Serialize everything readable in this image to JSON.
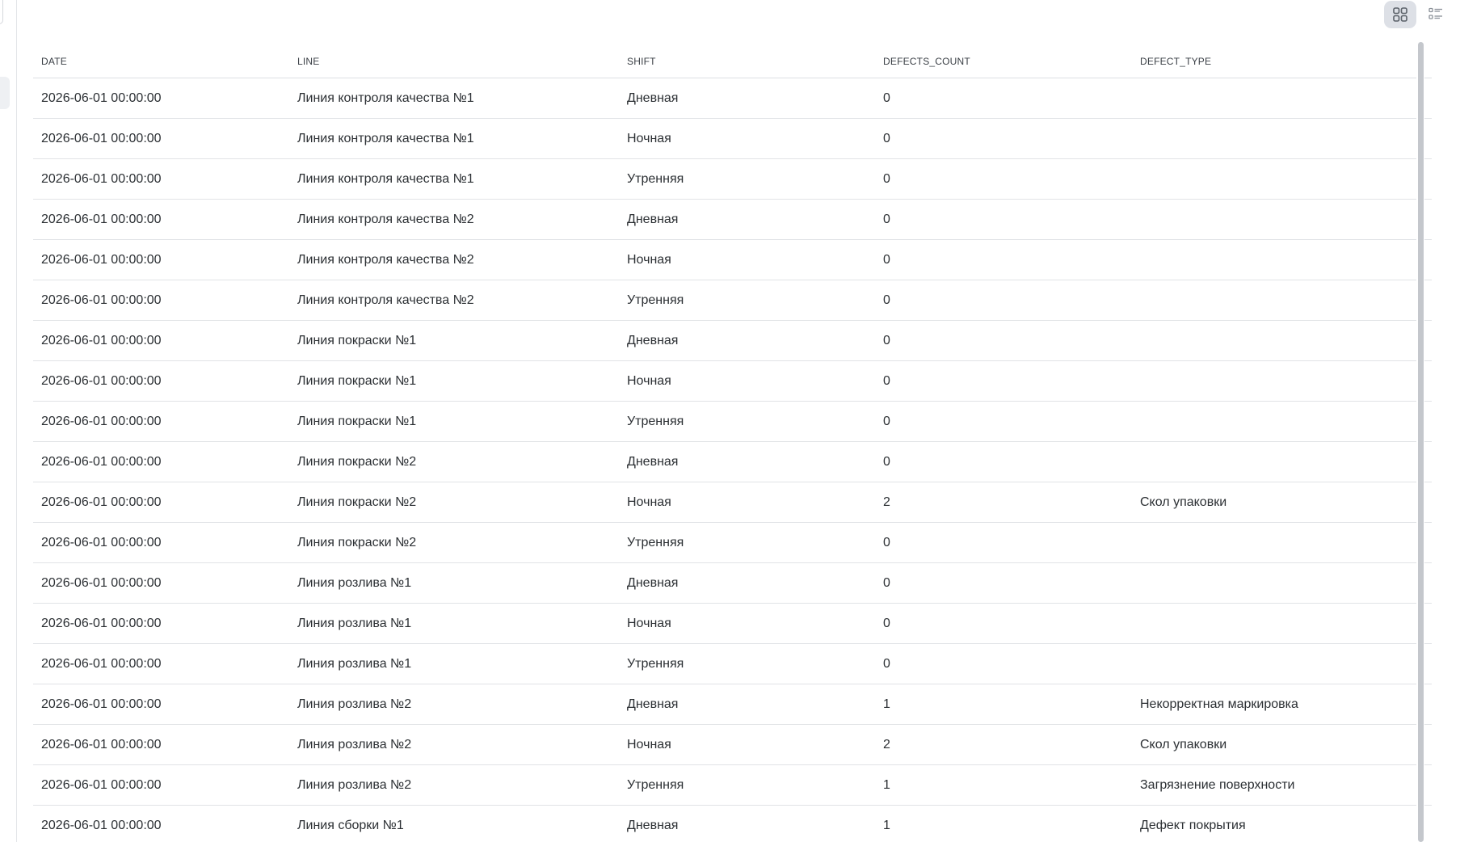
{
  "toolbar": {
    "grid_view_icon": "grid-icon",
    "list_view_icon": "list-icon",
    "active_view": "grid"
  },
  "table": {
    "columns": [
      "DATE",
      "LINE",
      "SHIFT",
      "DEFECTS_COUNT",
      "DEFECT_TYPE"
    ],
    "rows": [
      [
        "2026-06-01 00:00:00",
        "Линия контроля качества №1",
        "Дневная",
        "0",
        ""
      ],
      [
        "2026-06-01 00:00:00",
        "Линия контроля качества №1",
        "Ночная",
        "0",
        ""
      ],
      [
        "2026-06-01 00:00:00",
        "Линия контроля качества №1",
        "Утренняя",
        "0",
        ""
      ],
      [
        "2026-06-01 00:00:00",
        "Линия контроля качества №2",
        "Дневная",
        "0",
        ""
      ],
      [
        "2026-06-01 00:00:00",
        "Линия контроля качества №2",
        "Ночная",
        "0",
        ""
      ],
      [
        "2026-06-01 00:00:00",
        "Линия контроля качества №2",
        "Утренняя",
        "0",
        ""
      ],
      [
        "2026-06-01 00:00:00",
        "Линия покраски №1",
        "Дневная",
        "0",
        ""
      ],
      [
        "2026-06-01 00:00:00",
        "Линия покраски №1",
        "Ночная",
        "0",
        ""
      ],
      [
        "2026-06-01 00:00:00",
        "Линия покраски №1",
        "Утренняя",
        "0",
        ""
      ],
      [
        "2026-06-01 00:00:00",
        "Линия покраски №2",
        "Дневная",
        "0",
        ""
      ],
      [
        "2026-06-01 00:00:00",
        "Линия покраски №2",
        "Ночная",
        "2",
        "Скол упаковки"
      ],
      [
        "2026-06-01 00:00:00",
        "Линия покраски №2",
        "Утренняя",
        "0",
        ""
      ],
      [
        "2026-06-01 00:00:00",
        "Линия розлива №1",
        "Дневная",
        "0",
        ""
      ],
      [
        "2026-06-01 00:00:00",
        "Линия розлива №1",
        "Ночная",
        "0",
        ""
      ],
      [
        "2026-06-01 00:00:00",
        "Линия розлива №1",
        "Утренняя",
        "0",
        ""
      ],
      [
        "2026-06-01 00:00:00",
        "Линия розлива №2",
        "Дневная",
        "1",
        "Некорректная маркировка"
      ],
      [
        "2026-06-01 00:00:00",
        "Линия розлива №2",
        "Ночная",
        "2",
        "Скол упаковки"
      ],
      [
        "2026-06-01 00:00:00",
        "Линия розлива №2",
        "Утренняя",
        "1",
        "Загрязнение поверхности"
      ],
      [
        "2026-06-01 00:00:00",
        "Линия сборки №1",
        "Дневная",
        "1",
        "Дефект покрытия"
      ]
    ]
  },
  "colors": {
    "row_border": "#e1e3e6",
    "header_text": "#3a3f45",
    "cell_text": "#2b2f33",
    "active_toggle_bg": "#dde0e6",
    "scrollbar_thumb": "#c4c7cc"
  }
}
